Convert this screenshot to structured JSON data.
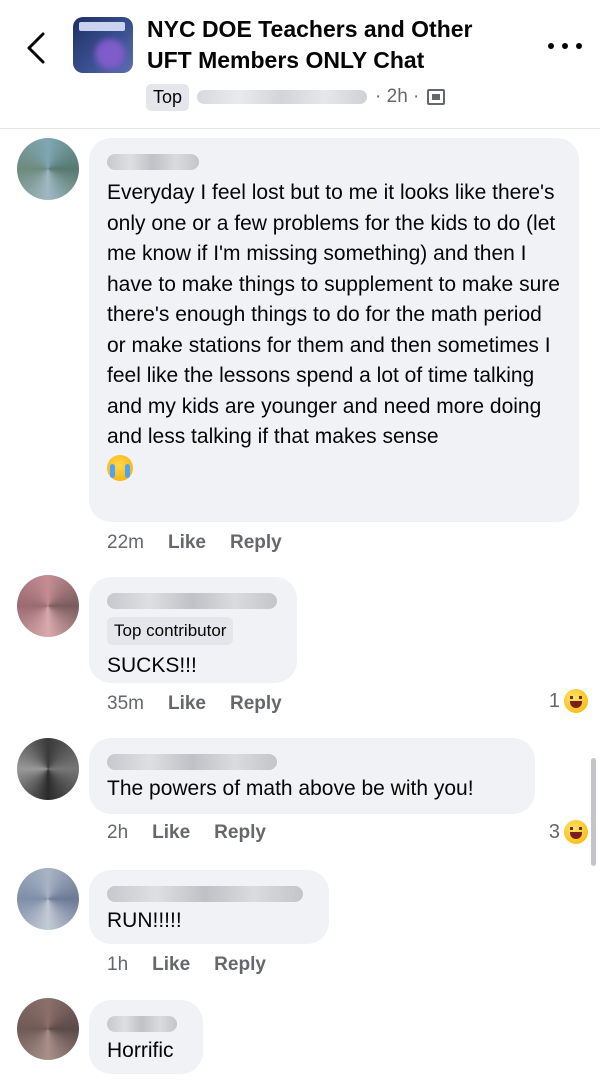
{
  "header": {
    "title": "NYC DOE Teachers and Other UFT Members ONLY Chat",
    "top_label": "Top",
    "time": "· 2h ·",
    "back_icon": "chevron-left-icon",
    "more_icon": "more-horizontal-icon",
    "privacy_icon": "group-icon"
  },
  "colors": {
    "bubble": "#f0f2f5",
    "meta": "#65676b",
    "text": "#050505"
  },
  "comments": [
    {
      "text": "Everyday I feel lost but to me it looks like there's only one or a few problems for the kids to do (let me know if I'm missing something) and then I have to make things to supplement to make sure there's enough things to do for the math period or make stations for them and then sometimes I feel like the lessons spend a lot of time talking and my kids are younger and need more doing and less talking if that makes sense",
      "emoji": "crying-face",
      "time": "22m",
      "like": "Like",
      "reply": "Reply"
    },
    {
      "badge": "Top contributor",
      "text": "SUCKS!!!",
      "time": "35m",
      "like": "Like",
      "reply": "Reply",
      "reaction_count": "1",
      "reaction_icon": "haha-icon"
    },
    {
      "text": "The powers of math above be with you!",
      "time": "2h",
      "like": "Like",
      "reply": "Reply",
      "reaction_count": "3",
      "reaction_icon": "haha-icon"
    },
    {
      "text": "RUN!!!!!",
      "time": "1h",
      "like": "Like",
      "reply": "Reply"
    },
    {
      "text": "Horrific"
    }
  ]
}
